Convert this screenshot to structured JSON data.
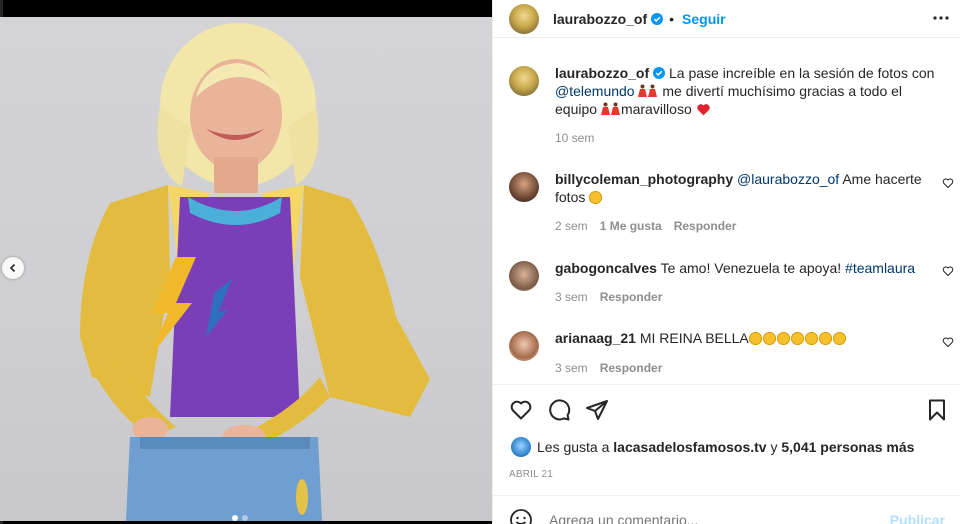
{
  "post": {
    "author": "laurabozzo_of",
    "follow_label": "Seguir",
    "bullet": "•"
  },
  "caption": {
    "author": "laurabozzo_of",
    "text_1": "La pase increíble en la sesión de fotos con",
    "mention": "@telemundo",
    "text_2": "me divertí muchísimo gracias a todo el equipo",
    "text_3": "maravilloso",
    "time": "10 sem"
  },
  "comments": [
    {
      "user": "billycoleman_photography",
      "mention": "@laurabozzo_of",
      "text": "Ame hacerte fotos",
      "time": "2 sem",
      "likes": "1 Me gusta",
      "reply": "Responder"
    },
    {
      "user": "gabogoncalves",
      "text": "Te amo! Venezuela te apoya!",
      "hashtag": "#teamlaura",
      "time": "3 sem",
      "reply": "Responder"
    },
    {
      "user": "arianaag_21",
      "text": "MI REINA BELLA",
      "time": "3 sem",
      "reply": "Responder"
    }
  ],
  "likes": {
    "prefix": "Les gusta a",
    "user": "lacasadelosfamosos.tv",
    "conj": "y",
    "others": "5,041 personas más"
  },
  "date": "ABRIL 21",
  "comment_box": {
    "placeholder": "Agrega un comentario...",
    "publish_label": "Publicar"
  },
  "colors": {
    "link_blue": "#0095f6",
    "mention_dark": "#00376b",
    "meta_gray": "#8e8e8e",
    "heart_red": "#ed1d3e",
    "gold_jacket": "#e8c34a",
    "purple_shirt": "#7a3fb8"
  },
  "carousel": {
    "current": 1,
    "total": 2
  }
}
